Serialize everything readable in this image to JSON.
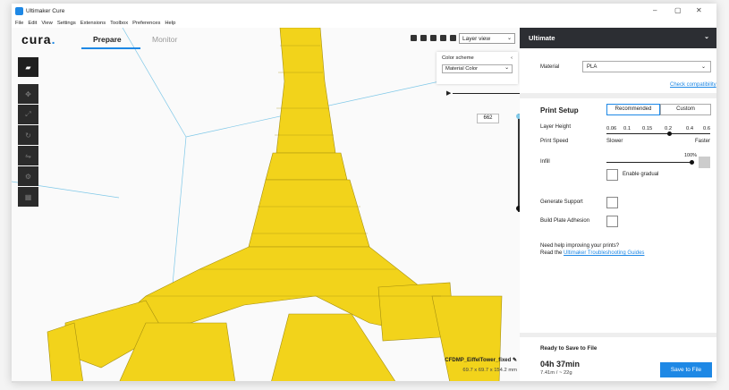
{
  "window": {
    "title": "Ultimaker Cure",
    "controls": [
      "–",
      "▢",
      "✕"
    ]
  },
  "menu": [
    "File",
    "Edit",
    "View",
    "Settings",
    "Extensions",
    "Toolbox",
    "Preferences",
    "Help"
  ],
  "header": {
    "logo_text": "cura",
    "logo_dot": ".",
    "tabs": {
      "prepare": "Prepare",
      "monitor": "Monitor"
    }
  },
  "view": {
    "layer_view_label": "Layer view"
  },
  "color_scheme": {
    "title": "Color scheme",
    "selected": "Material Color"
  },
  "layer_slider": {
    "value": "662"
  },
  "model": {
    "filename": "CFDMP_EiffelTower_fixed",
    "dimensions": "69.7 x 69.7 x 154.2 mm"
  },
  "right_panel": {
    "printer": "Ultimate",
    "material_label": "Material",
    "material_value": "PLA",
    "check_compat": "Check compatibility",
    "print_setup": "Print Setup",
    "recommended": "Recommended",
    "custom": "Custom",
    "layer_height_label": "Layer Height",
    "layer_heights": [
      "0.06",
      "0.1",
      "0.15",
      "0.2",
      "0.4",
      "0.6"
    ],
    "layer_height_selected": 0.2,
    "print_speed_label": "Print Speed",
    "slower": "Slower",
    "faster": "Faster",
    "infill_label": "Infill",
    "infill_percent": "100%",
    "infill_fraction": 1.0,
    "enable_gradual": "Enable gradual",
    "generate_support": "Generate Support",
    "build_plate_adhesion": "Build Plate Adhesion",
    "help_line1": "Need help improving your prints?",
    "help_read": "Read the",
    "help_link": "Ultimaker Troubleshooting Guides",
    "ready": "Ready to Save to File",
    "time": "04h 37min",
    "material_usage": "7.41m / ~ 22g",
    "save_button": "Save to File"
  },
  "colors": {
    "accent": "#1e88e5",
    "model": "#f2d31b",
    "dark": "#2c2e33"
  },
  "icons": [
    "app-icon",
    "open-folder-icon",
    "move-icon",
    "scale-icon",
    "rotate-icon",
    "mirror-icon",
    "per-model-settings-icon",
    "support-blocker-icon",
    "view-3d-icon",
    "view-front-icon",
    "view-top-icon",
    "view-left-icon",
    "view-right-icon",
    "pencil-icon",
    "chevron-down-icon",
    "chevron-left-icon",
    "play-icon"
  ]
}
